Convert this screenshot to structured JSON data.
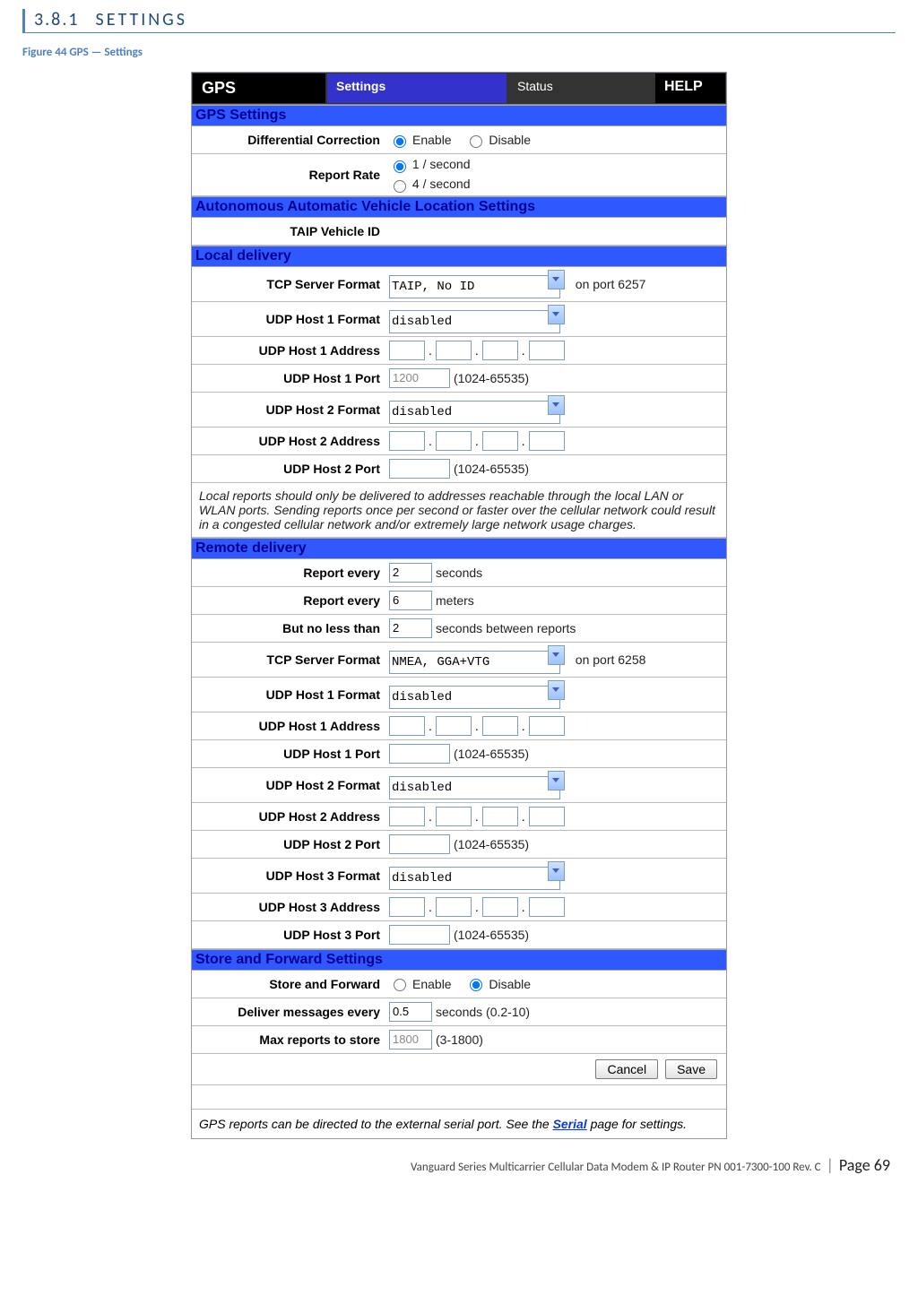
{
  "section": {
    "number": "3.8.1",
    "title": "SETTINGS"
  },
  "figure_caption": "Figure 44 GPS — Settings",
  "topbar": {
    "gps": "GPS",
    "settings": "Settings",
    "status": "Status",
    "help": "HELP"
  },
  "hdr": {
    "gps_settings": "GPS Settings",
    "aavls": "Autonomous Automatic Vehicle Location Settings",
    "local": "Local delivery",
    "remote": "Remote delivery",
    "store_fwd": "Store and Forward Settings"
  },
  "labels": {
    "diff_corr": "Differential Correction",
    "report_rate": "Report Rate",
    "taip": "TAIP Vehicle ID",
    "tcp_server_format": "TCP Server Format",
    "udp1_format": "UDP Host 1 Format",
    "udp1_addr": "UDP Host 1 Address",
    "udp1_port": "UDP Host 1 Port",
    "udp2_format": "UDP Host 2 Format",
    "udp2_addr": "UDP Host 2 Address",
    "udp2_port": "UDP Host 2 Port",
    "udp3_format": "UDP Host 3 Format",
    "udp3_addr": "UDP Host 3 Address",
    "udp3_port": "UDP Host 3 Port",
    "report_every_s": "Report every",
    "report_every_m": "Report every",
    "but_no_less": "But no less than",
    "store_forward": "Store and Forward",
    "deliver_every": "Deliver messages every",
    "max_reports": "Max reports to store"
  },
  "radios": {
    "enable": "Enable",
    "disable": "Disable",
    "rate1": "1 / second",
    "rate4": "4 / second"
  },
  "selects": {
    "local_tcp": "TAIP, No ID",
    "disabled": "disabled",
    "remote_tcp": "NMEA, GGA+VTG"
  },
  "values": {
    "local_udp1_port": "1200",
    "report_seconds": "2",
    "report_meters": "6",
    "min_seconds": "2",
    "deliver_every": "0.5",
    "max_reports": "1800"
  },
  "suffix": {
    "on_port_6257": "on port 6257",
    "on_port_6258": "on port 6258",
    "port_range": "(1024-65535)",
    "seconds": "seconds",
    "meters": "meters",
    "sec_between": "seconds between reports",
    "deliver_range": "seconds (0.2-10)",
    "max_range": "(3-1800)"
  },
  "note_local": "Local reports should only be delivered to addresses reachable through the local LAN or WLAN ports. Sending reports once per second or faster over the cellular network could result in a congested cellular network and/or extremely large network usage charges.",
  "footnote_pre": "GPS reports can be directed to the external serial port. See the ",
  "footnote_link": "Serial",
  "footnote_post": " page for settings.",
  "buttons": {
    "cancel": "Cancel",
    "save": "Save"
  },
  "footer": {
    "pn": "Vanguard Series Multicarrier Cellular Data Modem & IP Router PN 001-7300-100 Rev. C",
    "page": "Page 69"
  }
}
